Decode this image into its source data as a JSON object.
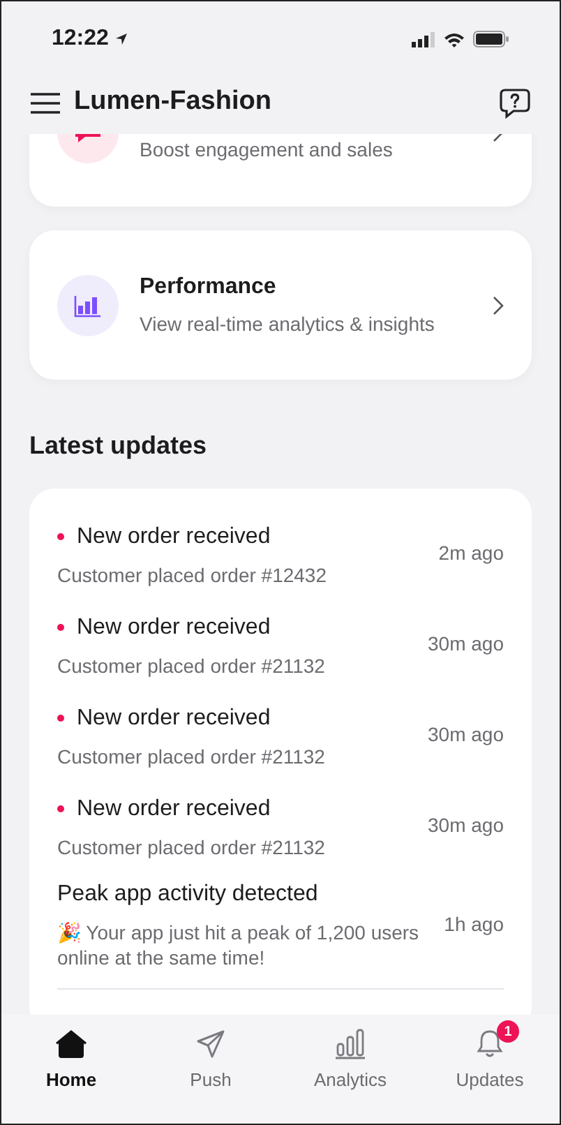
{
  "status_bar": {
    "time": "12:22"
  },
  "header": {
    "title": "Lumen-Fashion"
  },
  "feature_cards": [
    {
      "kind": "engagement",
      "subtitle": "Boost engagement and sales"
    },
    {
      "kind": "performance",
      "title": "Performance",
      "subtitle": "View real-time analytics & insights"
    }
  ],
  "updates": {
    "title": "Latest updates",
    "items": [
      {
        "unread": true,
        "title": "New order received",
        "text": "Customer placed order #12432",
        "time": "2m ago"
      },
      {
        "unread": true,
        "title": "New order received",
        "text": "Customer placed order #21132",
        "time": "30m ago"
      },
      {
        "unread": true,
        "title": "New order received",
        "text": "Customer placed order #21132",
        "time": "30m ago"
      },
      {
        "unread": true,
        "title": "New order received",
        "text": "Customer placed order #21132",
        "time": "30m ago"
      },
      {
        "unread": false,
        "title": "Peak app activity detected",
        "text": "🎉 Your app just hit a peak of 1,200 users online at the same time!",
        "time": "1h ago"
      }
    ]
  },
  "tab_bar": [
    {
      "kind": "home",
      "label": "Home",
      "selected": true
    },
    {
      "kind": "push",
      "label": "Push",
      "selected": false
    },
    {
      "kind": "analytics",
      "label": "Analytics",
      "selected": false
    },
    {
      "kind": "updates",
      "label": "Updates",
      "selected": false,
      "badge": "1"
    }
  ]
}
